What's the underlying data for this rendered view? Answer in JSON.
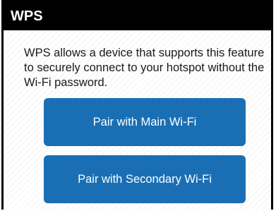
{
  "header": {
    "title": "WPS"
  },
  "main": {
    "description": "WPS allows a device that supports this feature to securely connect to your hotspot without the Wi-Fi password."
  },
  "buttons": {
    "pair_main_label": "Pair with Main Wi-Fi",
    "pair_secondary_label": "Pair with Secondary Wi-Fi"
  },
  "colors": {
    "header_background": "#000000",
    "button_background": "#1a6fb4",
    "button_text": "#ffffff"
  }
}
